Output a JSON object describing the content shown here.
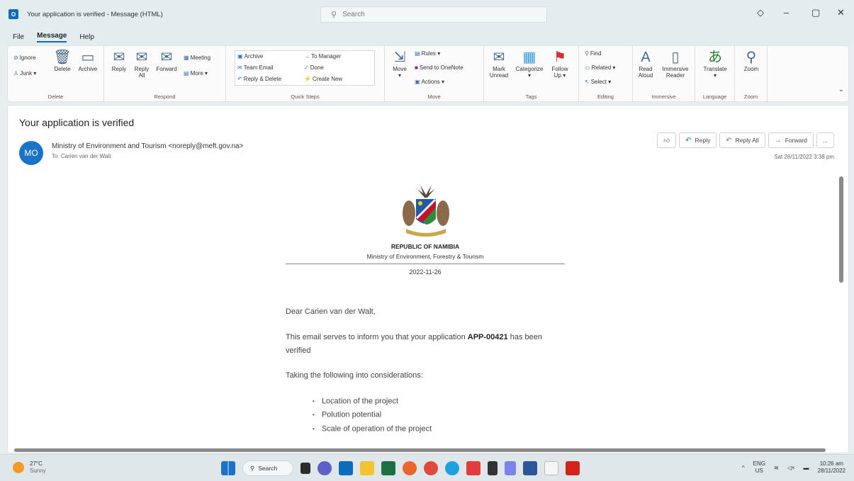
{
  "window": {
    "title": "Your application is verified  -  Message (HTML)",
    "search_placeholder": "Search"
  },
  "menu": [
    "File",
    "Message",
    "Help"
  ],
  "ribbon": {
    "delete": {
      "ignore": "Ignore",
      "junk": "Junk",
      "delete": "Delete",
      "archive": "Archive",
      "label": "Delete"
    },
    "respond": {
      "reply": "Reply",
      "reply_all_1": "Reply",
      "reply_all_2": "All",
      "forward": "Forward",
      "meeting": "Meeting",
      "more": "More",
      "label": "Respond"
    },
    "quick_steps": {
      "archive": "Archive",
      "team_email": "Team Email",
      "reply_delete": "Reply & Delete",
      "to_manager": "To Manager",
      "done": "Done",
      "create_new": "Create New",
      "label": "Quick Steps"
    },
    "move": {
      "move": "Move",
      "rules": "Rules",
      "onenote": "Send to OneNote",
      "actions": "Actions",
      "label": "Move"
    },
    "tags": {
      "mark_unread_1": "Mark",
      "mark_unread_2": "Unread",
      "categorize": "Categorize",
      "follow_up_1": "Follow",
      "follow_up_2": "Up",
      "label": "Tags"
    },
    "editing": {
      "find": "Find",
      "related": "Related",
      "select": "Select",
      "label": "Editing"
    },
    "immersive": {
      "read_aloud_1": "Read",
      "read_aloud_2": "Aloud",
      "immersive_reader_1": "Immersive",
      "immersive_reader_2": "Reader",
      "label": "Immersive"
    },
    "language": {
      "translate": "Translate",
      "label": "Language"
    },
    "zoom": {
      "zoom": "Zoom",
      "label": "Zoom"
    }
  },
  "message": {
    "subject": "Your application is verified",
    "avatar_initials": "MO",
    "sender": "Ministry of Environment and Tourism <noreply@meft.gov.na>",
    "to_label": "To",
    "to": "Carien van der Walt",
    "timestamp": "Sat 26/11/2022 3:38 pm",
    "actions": {
      "reply": "Reply",
      "reply_all": "Reply All",
      "forward": "Forward",
      "more": "..."
    }
  },
  "email": {
    "republic": "REPUBLIC OF NAMIBIA",
    "ministry": "Ministry of Environment, Forestry & Tourism",
    "date": "2022-11-26",
    "greeting": "Dear Carien van der Walt,",
    "p1_before": "This email serves to inform you that your application ",
    "p1_app": "APP-00421",
    "p1_after": " has been verified",
    "p2": "Taking the following into considerations:",
    "bullets": [
      "Location of the project",
      "Polution potential",
      "Scale of operation of the project"
    ]
  },
  "taskbar": {
    "temp": "27°C",
    "weather": "Sunny",
    "search": "Search",
    "lang_1": "ENG",
    "lang_2": "US",
    "time": "10:26 am",
    "date": "28/11/2022"
  },
  "colors": {
    "accent": "#0f6cbd",
    "avatar": "#1a73c9"
  }
}
